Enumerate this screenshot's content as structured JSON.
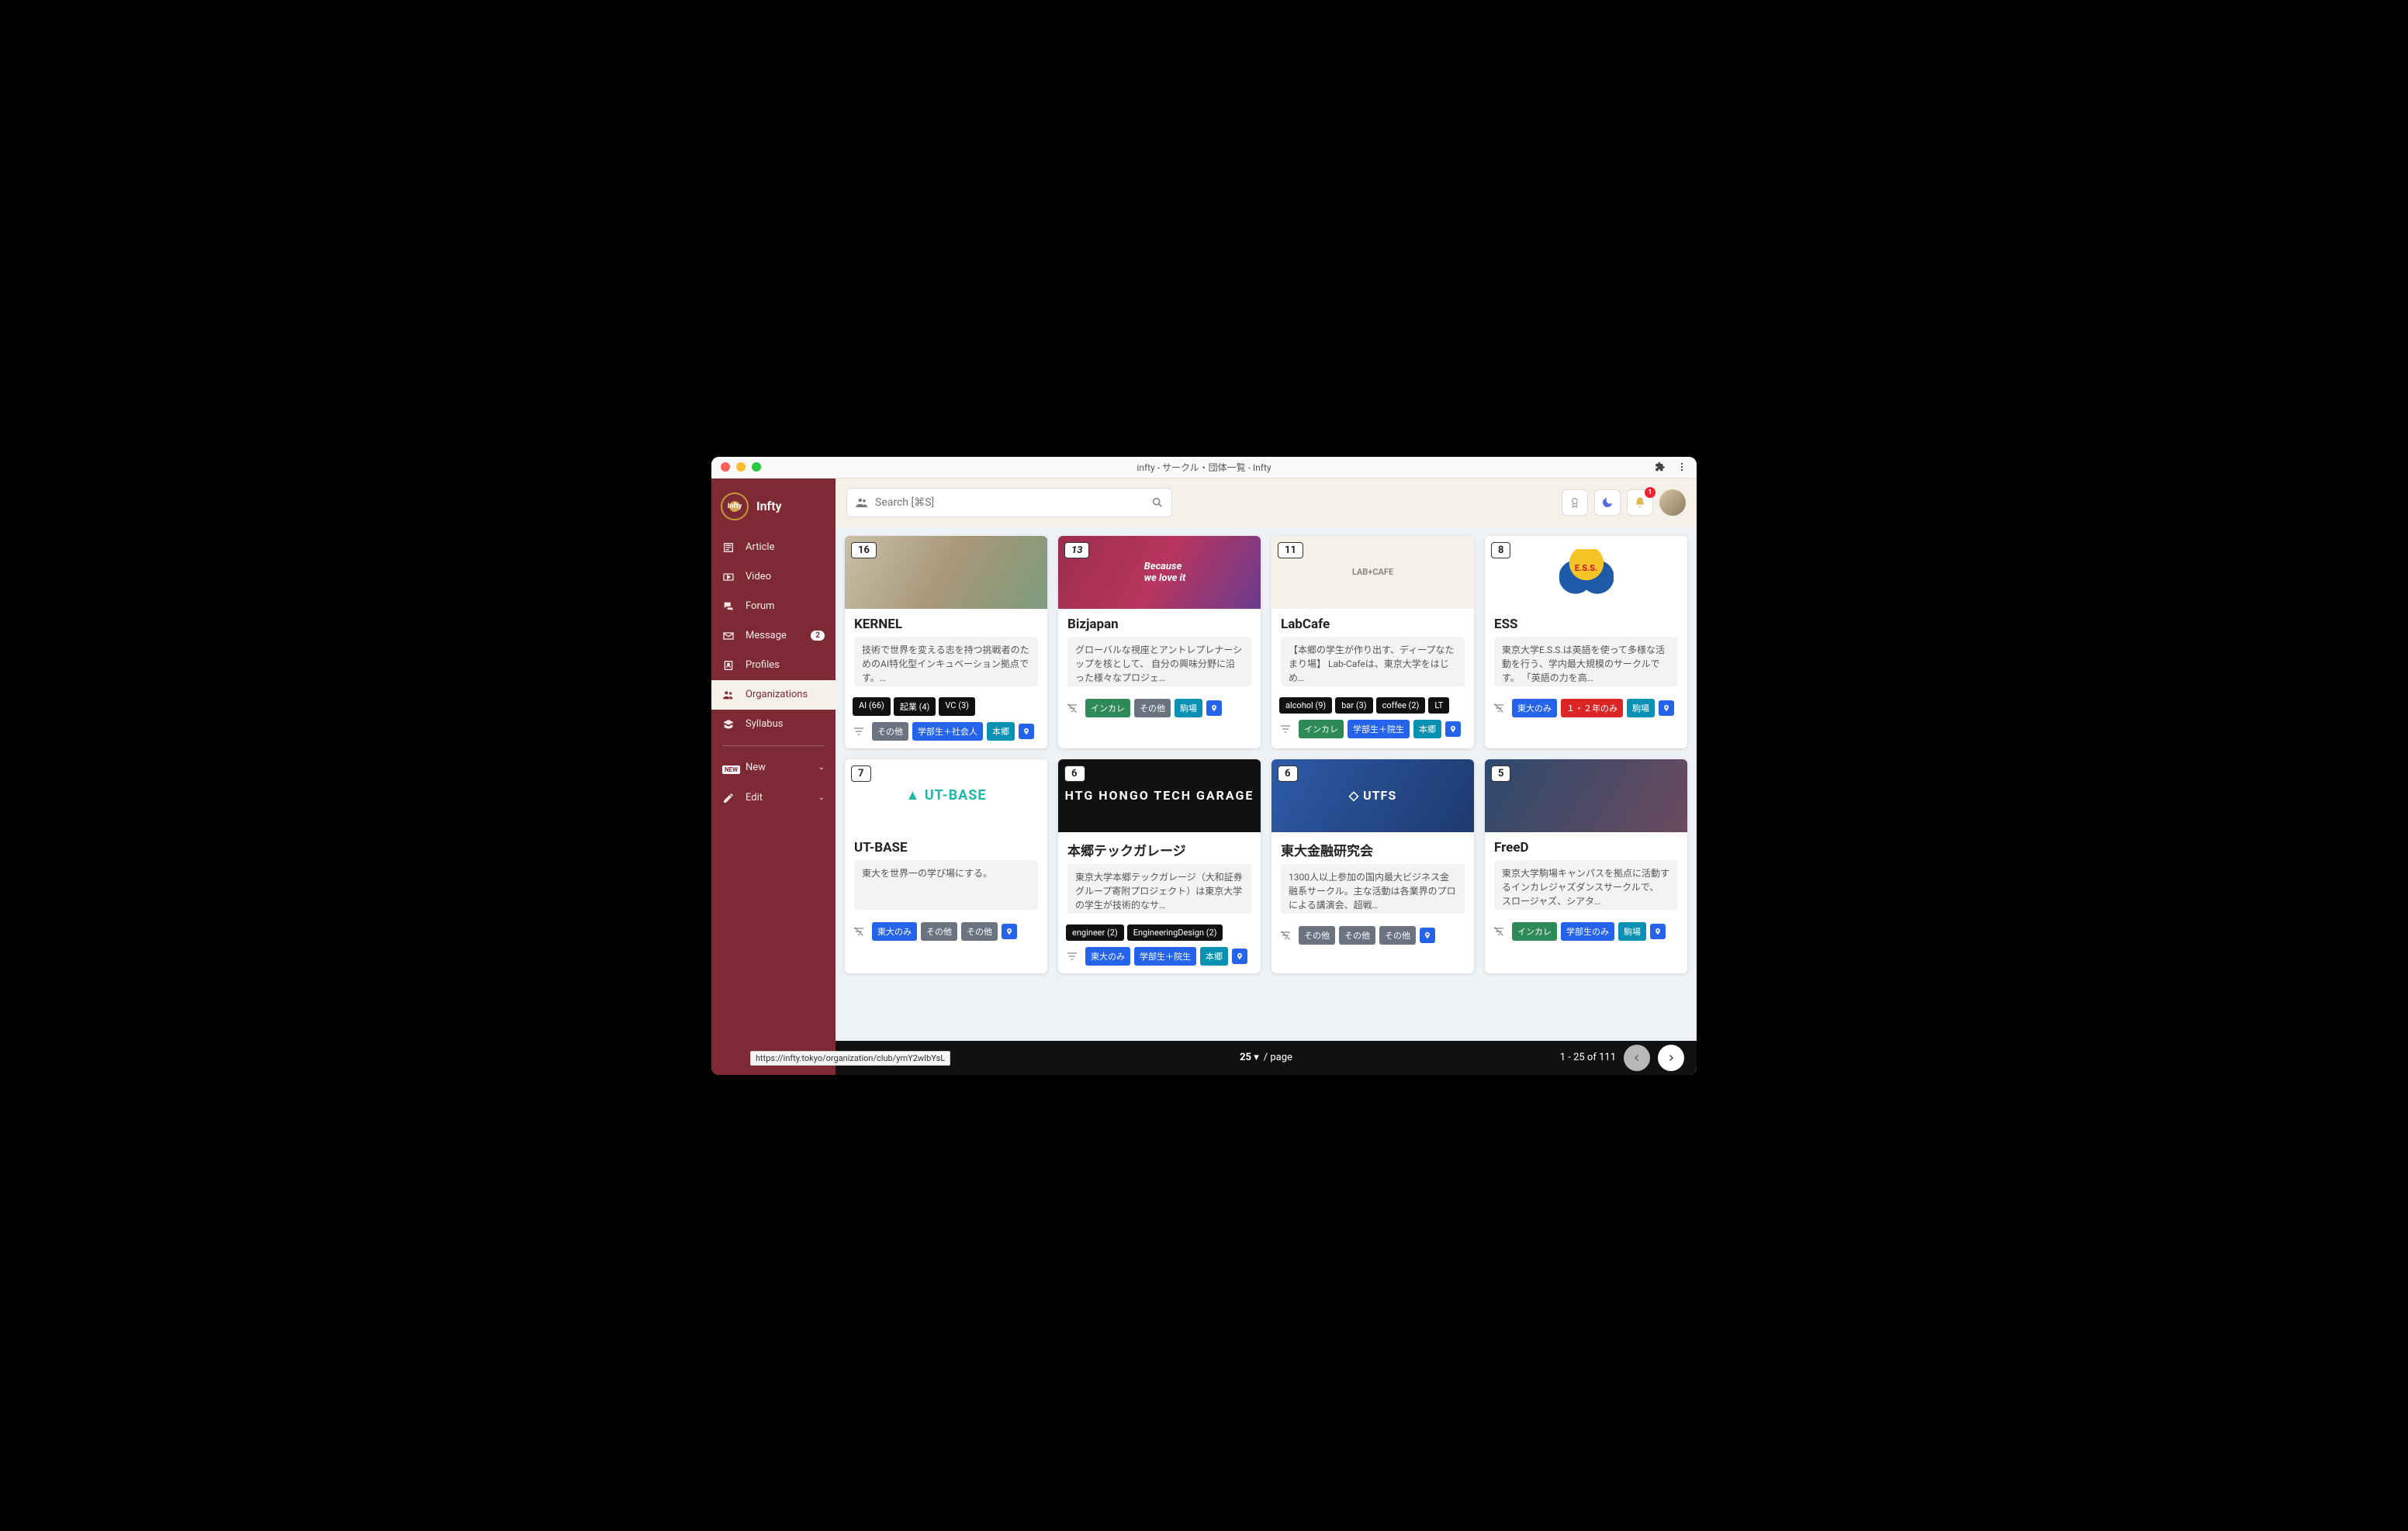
{
  "window_title": "infty - サークル・団体一覧 - Infty",
  "brand_name": "Infty",
  "search_placeholder": "Search [⌘S]",
  "notification_count": "1",
  "nav": [
    {
      "icon": "article",
      "label": "Article"
    },
    {
      "icon": "video",
      "label": "Video"
    },
    {
      "icon": "forum",
      "label": "Forum"
    },
    {
      "icon": "mail",
      "label": "Message",
      "badge": "2"
    },
    {
      "icon": "profile",
      "label": "Profiles"
    },
    {
      "icon": "org",
      "label": "Organizations",
      "active": true
    },
    {
      "icon": "book",
      "label": "Syllabus"
    }
  ],
  "nav2": [
    {
      "icon": "new",
      "label": "New"
    },
    {
      "icon": "edit",
      "label": "Edit"
    }
  ],
  "cards": [
    {
      "count": "16",
      "title": "KERNEL",
      "desc": "技術で世界を変える志を持つ挑戦者のためのAI特化型インキュベーション拠点です。…",
      "tags": [
        "AI (66)",
        "起業 (4)",
        "VC (3)"
      ],
      "chips": [
        {
          "t": "その他",
          "c": "c-gray"
        },
        {
          "t": "学部生＋社会人",
          "c": "c-blue"
        },
        {
          "t": "本郷",
          "c": "c-cyan"
        }
      ],
      "img": "img1"
    },
    {
      "count": "13",
      "title": "Bizjapan",
      "desc": "グローバルな視座とアントレプレナーシップを核として、 自分の興味分野に沿った様々なプロジェ…",
      "tags": [],
      "chips": [
        {
          "t": "インカレ",
          "c": "c-green"
        },
        {
          "t": "その他",
          "c": "c-gray"
        },
        {
          "t": "駒場",
          "c": "c-cyan"
        }
      ],
      "img": "img2",
      "img_text": "Because\nwe love it"
    },
    {
      "count": "11",
      "title": "LabCafe",
      "desc": "【本郷の学生が作り出す、ディープなたまり場】\nLab-Cafeは、東京大学をはじめ…",
      "tags": [
        "alcohol (9)",
        "bar (3)",
        "coffee (2)",
        "LT"
      ],
      "chips": [
        {
          "t": "インカレ",
          "c": "c-green"
        },
        {
          "t": "学部生＋院生",
          "c": "c-blue"
        },
        {
          "t": "本郷",
          "c": "c-cyan"
        }
      ],
      "img": "img3",
      "img_text": "LAB+CAFE"
    },
    {
      "count": "8",
      "title": "ESS",
      "desc": "東京大学E.S.S.は英語を使って多様な活動を行う、学内最大規模のサークルです。 「英語の力を高…",
      "tags": [],
      "chips": [
        {
          "t": "東大のみ",
          "c": "c-blue"
        },
        {
          "t": "１・２年のみ",
          "c": "c-red"
        },
        {
          "t": "駒場",
          "c": "c-cyan"
        }
      ],
      "img": "img4",
      "ess": true
    },
    {
      "count": "7",
      "title": "UT-BASE",
      "desc": "東大を世界一の学び場にする。",
      "tags": [],
      "chips": [
        {
          "t": "東大のみ",
          "c": "c-blue"
        },
        {
          "t": "その他",
          "c": "c-gray"
        },
        {
          "t": "その他",
          "c": "c-gray"
        }
      ],
      "img": "img5",
      "img_text": "▲ UT-BASE"
    },
    {
      "count": "6",
      "title": "本郷テックガレージ",
      "desc": "東京大学本郷テックガレージ（大和証券グループ寄附プロジェクト）は東京大学の学生が技術的なサ…",
      "tags": [
        "engineer (2)",
        "EngineeringDesign (2)"
      ],
      "chips": [
        {
          "t": "東大のみ",
          "c": "c-blue"
        },
        {
          "t": "学部生＋院生",
          "c": "c-blue"
        },
        {
          "t": "本郷",
          "c": "c-cyan"
        }
      ],
      "img": "img6",
      "img_text": "HTG  HONGO TECH GARAGE"
    },
    {
      "count": "6",
      "title": "東大金融研究会",
      "desc": "1300人以上参加の国内最大ビジネス金融系サークル。主な活動は各業界のプロによる講演会、超戦…",
      "tags": [],
      "chips": [
        {
          "t": "その他",
          "c": "c-gray"
        },
        {
          "t": "その他",
          "c": "c-gray"
        },
        {
          "t": "その他",
          "c": "c-gray"
        }
      ],
      "img": "img7",
      "img_text": "◇ UTFS"
    },
    {
      "count": "5",
      "title": "FreeD",
      "desc": "東京大学駒場キャンパスを拠点に活動するインカレジャズダンスサークルで、 スロージャズ、シアタ…",
      "tags": [],
      "chips": [
        {
          "t": "インカレ",
          "c": "c-green"
        },
        {
          "t": "学部生のみ",
          "c": "c-blue"
        },
        {
          "t": "駒場",
          "c": "c-cyan"
        }
      ],
      "img": "img8"
    }
  ],
  "page_size": "25",
  "per_page_label": "/ page",
  "range_text": "1 - 25 of 111",
  "status_url": "https://infty.tokyo/organization/club/ymY2wIbYsL"
}
